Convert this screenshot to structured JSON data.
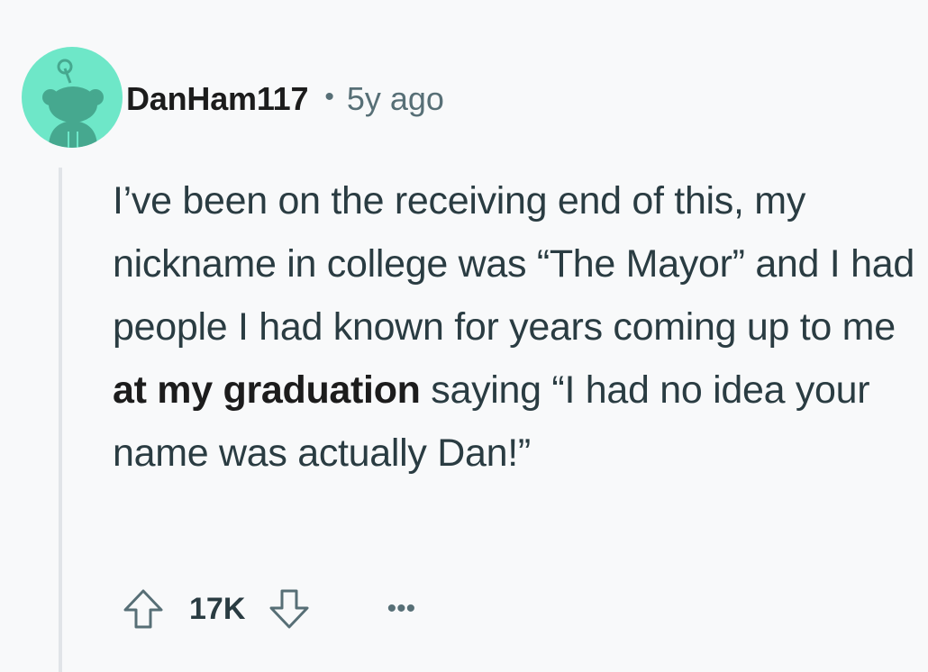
{
  "comment": {
    "username": "DanHam117",
    "separator": "•",
    "age": "5y ago",
    "body": {
      "part1": "I’ve been on the receiving end of this, my nickname in college was “The Mayor” and I had people I had known for years coming up to me ",
      "bold": "at my graduation",
      "part2": " saying “I had no idea your name was actually Dan!”"
    },
    "score": "17K",
    "more_label": "•••"
  },
  "icons": {
    "avatar": "reddit-snoo-avatar",
    "upvote": "arrow-up-outline-icon",
    "downvote": "arrow-down-outline-icon",
    "more": "ellipsis-icon"
  },
  "colors": {
    "background": "#f8f9fa",
    "avatar_bg": "#6ee7c8",
    "meta_gray": "#576f76",
    "text": "#2a3c42"
  }
}
